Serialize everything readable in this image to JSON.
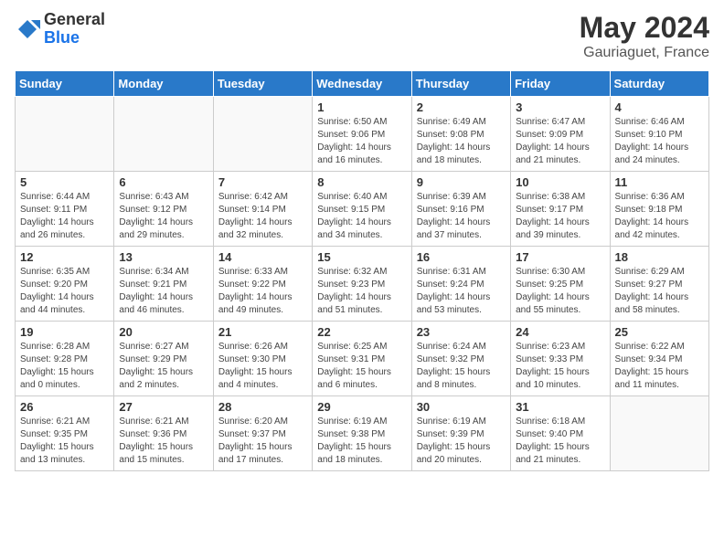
{
  "logo": {
    "general": "General",
    "blue": "Blue"
  },
  "header": {
    "title": "May 2024",
    "subtitle": "Gauriaguet, France"
  },
  "weekdays": [
    "Sunday",
    "Monday",
    "Tuesday",
    "Wednesday",
    "Thursday",
    "Friday",
    "Saturday"
  ],
  "weeks": [
    [
      {
        "day": "",
        "info": ""
      },
      {
        "day": "",
        "info": ""
      },
      {
        "day": "",
        "info": ""
      },
      {
        "day": "1",
        "info": "Sunrise: 6:50 AM\nSunset: 9:06 PM\nDaylight: 14 hours and 16 minutes."
      },
      {
        "day": "2",
        "info": "Sunrise: 6:49 AM\nSunset: 9:08 PM\nDaylight: 14 hours and 18 minutes."
      },
      {
        "day": "3",
        "info": "Sunrise: 6:47 AM\nSunset: 9:09 PM\nDaylight: 14 hours and 21 minutes."
      },
      {
        "day": "4",
        "info": "Sunrise: 6:46 AM\nSunset: 9:10 PM\nDaylight: 14 hours and 24 minutes."
      }
    ],
    [
      {
        "day": "5",
        "info": "Sunrise: 6:44 AM\nSunset: 9:11 PM\nDaylight: 14 hours and 26 minutes."
      },
      {
        "day": "6",
        "info": "Sunrise: 6:43 AM\nSunset: 9:12 PM\nDaylight: 14 hours and 29 minutes."
      },
      {
        "day": "7",
        "info": "Sunrise: 6:42 AM\nSunset: 9:14 PM\nDaylight: 14 hours and 32 minutes."
      },
      {
        "day": "8",
        "info": "Sunrise: 6:40 AM\nSunset: 9:15 PM\nDaylight: 14 hours and 34 minutes."
      },
      {
        "day": "9",
        "info": "Sunrise: 6:39 AM\nSunset: 9:16 PM\nDaylight: 14 hours and 37 minutes."
      },
      {
        "day": "10",
        "info": "Sunrise: 6:38 AM\nSunset: 9:17 PM\nDaylight: 14 hours and 39 minutes."
      },
      {
        "day": "11",
        "info": "Sunrise: 6:36 AM\nSunset: 9:18 PM\nDaylight: 14 hours and 42 minutes."
      }
    ],
    [
      {
        "day": "12",
        "info": "Sunrise: 6:35 AM\nSunset: 9:20 PM\nDaylight: 14 hours and 44 minutes."
      },
      {
        "day": "13",
        "info": "Sunrise: 6:34 AM\nSunset: 9:21 PM\nDaylight: 14 hours and 46 minutes."
      },
      {
        "day": "14",
        "info": "Sunrise: 6:33 AM\nSunset: 9:22 PM\nDaylight: 14 hours and 49 minutes."
      },
      {
        "day": "15",
        "info": "Sunrise: 6:32 AM\nSunset: 9:23 PM\nDaylight: 14 hours and 51 minutes."
      },
      {
        "day": "16",
        "info": "Sunrise: 6:31 AM\nSunset: 9:24 PM\nDaylight: 14 hours and 53 minutes."
      },
      {
        "day": "17",
        "info": "Sunrise: 6:30 AM\nSunset: 9:25 PM\nDaylight: 14 hours and 55 minutes."
      },
      {
        "day": "18",
        "info": "Sunrise: 6:29 AM\nSunset: 9:27 PM\nDaylight: 14 hours and 58 minutes."
      }
    ],
    [
      {
        "day": "19",
        "info": "Sunrise: 6:28 AM\nSunset: 9:28 PM\nDaylight: 15 hours and 0 minutes."
      },
      {
        "day": "20",
        "info": "Sunrise: 6:27 AM\nSunset: 9:29 PM\nDaylight: 15 hours and 2 minutes."
      },
      {
        "day": "21",
        "info": "Sunrise: 6:26 AM\nSunset: 9:30 PM\nDaylight: 15 hours and 4 minutes."
      },
      {
        "day": "22",
        "info": "Sunrise: 6:25 AM\nSunset: 9:31 PM\nDaylight: 15 hours and 6 minutes."
      },
      {
        "day": "23",
        "info": "Sunrise: 6:24 AM\nSunset: 9:32 PM\nDaylight: 15 hours and 8 minutes."
      },
      {
        "day": "24",
        "info": "Sunrise: 6:23 AM\nSunset: 9:33 PM\nDaylight: 15 hours and 10 minutes."
      },
      {
        "day": "25",
        "info": "Sunrise: 6:22 AM\nSunset: 9:34 PM\nDaylight: 15 hours and 11 minutes."
      }
    ],
    [
      {
        "day": "26",
        "info": "Sunrise: 6:21 AM\nSunset: 9:35 PM\nDaylight: 15 hours and 13 minutes."
      },
      {
        "day": "27",
        "info": "Sunrise: 6:21 AM\nSunset: 9:36 PM\nDaylight: 15 hours and 15 minutes."
      },
      {
        "day": "28",
        "info": "Sunrise: 6:20 AM\nSunset: 9:37 PM\nDaylight: 15 hours and 17 minutes."
      },
      {
        "day": "29",
        "info": "Sunrise: 6:19 AM\nSunset: 9:38 PM\nDaylight: 15 hours and 18 minutes."
      },
      {
        "day": "30",
        "info": "Sunrise: 6:19 AM\nSunset: 9:39 PM\nDaylight: 15 hours and 20 minutes."
      },
      {
        "day": "31",
        "info": "Sunrise: 6:18 AM\nSunset: 9:40 PM\nDaylight: 15 hours and 21 minutes."
      },
      {
        "day": "",
        "info": ""
      }
    ]
  ]
}
